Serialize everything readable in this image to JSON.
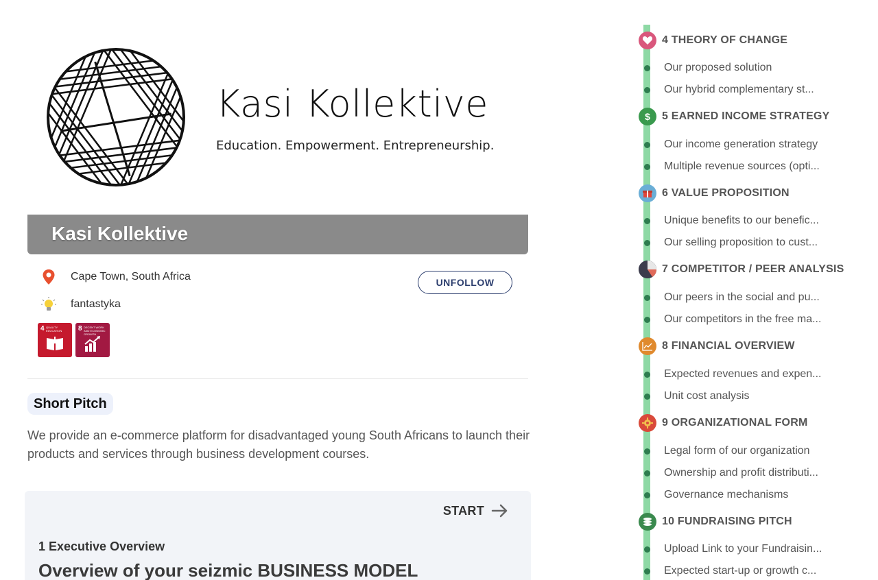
{
  "brand": {
    "title": "Kasi Kollektive",
    "tagline": "Education. Empowerment. Entrepreneurship."
  },
  "profile": {
    "name": "Kasi Kollektive",
    "location": "Cape Town, South Africa",
    "author": "fantastyka",
    "unfollow_label": "UNFOLLOW",
    "sdgs": [
      {
        "num": "4",
        "label": "QUALITY EDUCATION",
        "color": "#c5192d"
      },
      {
        "num": "8",
        "label": "DECENT WORK AND ECONOMIC GROWTH",
        "color": "#a21942"
      }
    ]
  },
  "pitch": {
    "label": "Short Pitch",
    "text": "We provide an e-commerce platform for disadvantaged young South Africans to launch their products and services through business development courses."
  },
  "executive": {
    "start_label": "START",
    "section": "1 Executive Overview",
    "title": "Overview of your seizmic BUSINESS MODEL"
  },
  "timeline": {
    "sections": [
      {
        "title": "4 THEORY OF CHANGE",
        "icon": "heart-icon",
        "color": "#d9577c",
        "items": [
          "Our proposed solution",
          "Our hybrid complementary st..."
        ]
      },
      {
        "title": "5 EARNED INCOME STRATEGY",
        "icon": "dollar-icon",
        "color": "#3a9a4e",
        "items": [
          "Our income generation strategy",
          "Multiple revenue sources (opti..."
        ]
      },
      {
        "title": "6 VALUE PROPOSITION",
        "icon": "gift-icon",
        "color": "#6aaed6",
        "items": [
          "Unique benefits to our benefic...",
          "Our selling proposition to cust..."
        ]
      },
      {
        "title": "7 COMPETITOR / PEER ANALYSIS",
        "icon": "pie-chart-icon",
        "color": "#3c3c4c",
        "items": [
          "Our peers in the social and pu...",
          "Our competitors in the free ma..."
        ]
      },
      {
        "title": "8 FINANCIAL OVERVIEW",
        "icon": "chart-line-icon",
        "color": "#e08a2e",
        "items": [
          "Expected revenues and expen...",
          "Unit cost analysis"
        ]
      },
      {
        "title": "9 ORGANIZATIONAL FORM",
        "icon": "gear-icon",
        "color": "#d94a3a",
        "items": [
          "Legal form of our organization",
          "Ownership and profit distributi...",
          "Governance mechanisms"
        ]
      },
      {
        "title": "10 FUNDRAISING PITCH",
        "icon": "coins-icon",
        "color": "#3a8a4e",
        "items": [
          "Upload Link to your Fundraisin...",
          "Expected start-up or growth c..."
        ]
      }
    ]
  }
}
